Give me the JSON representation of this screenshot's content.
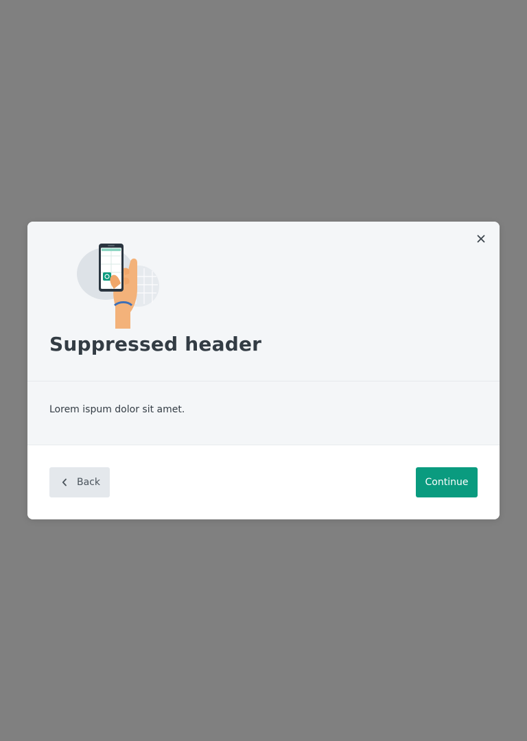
{
  "modal": {
    "title": "Suppressed header",
    "body_text": "Lorem ispum dolor sit amet.",
    "illustration": "hand-holding-phone-illustration",
    "close_icon": "close-icon"
  },
  "footer": {
    "back_label": "Back",
    "back_icon": "chevron-left-icon",
    "continue_label": "Continue"
  },
  "colors": {
    "overlay": "#808080",
    "header_background": "#f4f6f8",
    "primary": "#0a9b7f",
    "secondary_button": "#e4e8ec",
    "text": "#333c44"
  }
}
